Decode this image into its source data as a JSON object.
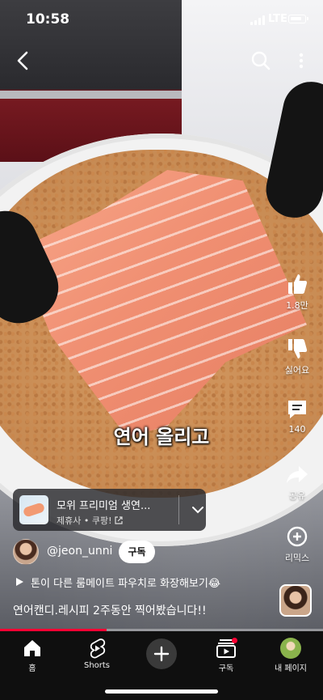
{
  "status_bar": {
    "time": "10:58",
    "network": "LTE"
  },
  "video": {
    "caption": "연어 올리고",
    "progress": 0.33
  },
  "actions": {
    "like_count": "1.8만",
    "dislike_label": "싫어요",
    "comment_count": "140",
    "share_label": "공유",
    "remix_label": "리믹스"
  },
  "product": {
    "title": "모위 프리미엄 생연...",
    "subtitle": "제휴사 • 쿠팡!"
  },
  "channel": {
    "handle": "@jeon_unni",
    "subscribe_label": "구독"
  },
  "playlist": {
    "text": "톤이 다른 룸메이트 파우치로 화장해보기😂"
  },
  "description": "연어캔디.레시피 2주동안 찍어봤습니다!!",
  "nav": {
    "home": "홈",
    "shorts": "Shorts",
    "subscriptions": "구독",
    "you": "내 페이지"
  },
  "colors": {
    "accent": "#ff0033",
    "nav_bg": "#0f0f0f"
  }
}
